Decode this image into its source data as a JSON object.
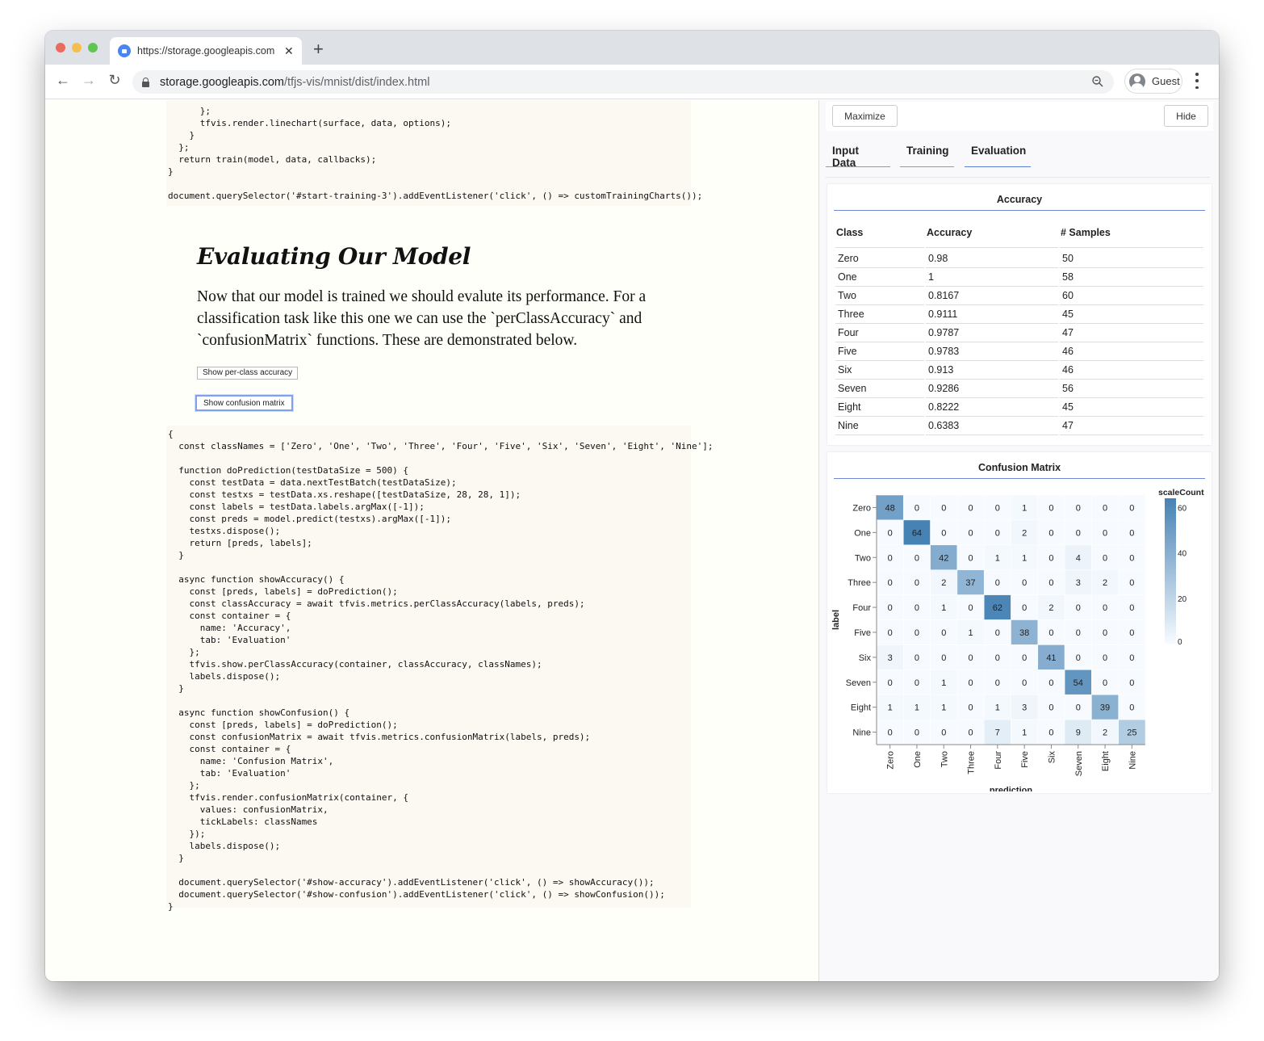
{
  "browser": {
    "tab_title": "https://storage.googleapis.com",
    "tab_close": "✕",
    "new_tab": "+",
    "url_host": "storage.googleapis.com",
    "url_path": "/tfjs-vis/mnist/dist/index.html",
    "profile_label": "Guest",
    "back_icon": "←",
    "forward_icon": "→",
    "reload_icon": "↻"
  },
  "main": {
    "code_top": [
      "      };",
      "      tfvis.render.linechart(surface, data, options);",
      "    }",
      "  };",
      "  return train(model, data, callbacks);",
      "}",
      "",
      "document.querySelector('#start-training-3').addEventListener('click', () => customTrainingCharts());"
    ],
    "heading": "Evaluating Our Model",
    "paragraph": "Now that our model is trained we should evalute its performance. For a classification task like this one we can use the `perClassAccuracy` and `confusionMatrix` functions. These are demonstrated below.",
    "buttons": {
      "accuracy": "Show per-class accuracy",
      "confusion": "Show confusion matrix"
    },
    "code_bottom": [
      "{",
      "  const classNames = ['Zero', 'One', 'Two', 'Three', 'Four', 'Five', 'Six', 'Seven', 'Eight', 'Nine'];",
      "",
      "  function doPrediction(testDataSize = 500) {",
      "    const testData = data.nextTestBatch(testDataSize);",
      "    const testxs = testData.xs.reshape([testDataSize, 28, 28, 1]);",
      "    const labels = testData.labels.argMax([-1]);",
      "    const preds = model.predict(testxs).argMax([-1]);",
      "    testxs.dispose();",
      "    return [preds, labels];",
      "  }",
      "",
      "  async function showAccuracy() {",
      "    const [preds, labels] = doPrediction();",
      "    const classAccuracy = await tfvis.metrics.perClassAccuracy(labels, preds);",
      "    const container = {",
      "      name: 'Accuracy',",
      "      tab: 'Evaluation'",
      "    };",
      "    tfvis.show.perClassAccuracy(container, classAccuracy, classNames);",
      "    labels.dispose();",
      "  }",
      "",
      "  async function showConfusion() {",
      "    const [preds, labels] = doPrediction();",
      "    const confusionMatrix = await tfvis.metrics.confusionMatrix(labels, preds);",
      "    const container = {",
      "      name: 'Confusion Matrix',",
      "      tab: 'Evaluation'",
      "    };",
      "    tfvis.render.confusionMatrix(container, {",
      "      values: confusionMatrix,",
      "      tickLabels: classNames",
      "    });",
      "    labels.dispose();",
      "  }",
      "",
      "  document.querySelector('#show-accuracy').addEventListener('click', () => showAccuracy());",
      "  document.querySelector('#show-confusion').addEventListener('click', () => showConfusion());",
      "}"
    ]
  },
  "visor": {
    "maximize_label": "Maximize",
    "hide_label": "Hide",
    "tabs": [
      {
        "label": "Input Data",
        "active": false
      },
      {
        "label": "Training",
        "active": false
      },
      {
        "label": "Evaluation",
        "active": true
      }
    ],
    "accent": "#5b7fd4",
    "accuracy": {
      "title": "Accuracy",
      "headers": [
        "Class",
        "Accuracy",
        "# Samples"
      ],
      "rows": [
        [
          "Zero",
          "0.98",
          "50"
        ],
        [
          "One",
          "1",
          "58"
        ],
        [
          "Two",
          "0.8167",
          "60"
        ],
        [
          "Three",
          "0.9111",
          "45"
        ],
        [
          "Four",
          "0.9787",
          "47"
        ],
        [
          "Five",
          "0.9783",
          "46"
        ],
        [
          "Six",
          "0.913",
          "46"
        ],
        [
          "Seven",
          "0.9286",
          "56"
        ],
        [
          "Eight",
          "0.8222",
          "45"
        ],
        [
          "Nine",
          "0.6383",
          "47"
        ]
      ]
    }
  },
  "chart_data": {
    "type": "heatmap",
    "title": "Confusion Matrix",
    "xlabel": "prediction",
    "ylabel": "label",
    "categories": [
      "Zero",
      "One",
      "Two",
      "Three",
      "Four",
      "Five",
      "Six",
      "Seven",
      "Eight",
      "Nine"
    ],
    "values": [
      [
        48,
        0,
        0,
        0,
        0,
        1,
        0,
        0,
        0,
        0
      ],
      [
        0,
        64,
        0,
        0,
        0,
        2,
        0,
        0,
        0,
        0
      ],
      [
        0,
        0,
        42,
        0,
        1,
        1,
        0,
        4,
        0,
        0
      ],
      [
        0,
        0,
        2,
        37,
        0,
        0,
        0,
        3,
        2,
        0
      ],
      [
        0,
        0,
        1,
        0,
        62,
        0,
        2,
        0,
        0,
        0
      ],
      [
        0,
        0,
        0,
        1,
        0,
        38,
        0,
        0,
        0,
        0
      ],
      [
        3,
        0,
        0,
        0,
        0,
        0,
        41,
        0,
        0,
        0
      ],
      [
        0,
        0,
        1,
        0,
        0,
        0,
        0,
        54,
        0,
        0
      ],
      [
        1,
        1,
        1,
        0,
        1,
        3,
        0,
        0,
        39,
        0
      ],
      [
        0,
        0,
        0,
        0,
        7,
        1,
        0,
        9,
        2,
        25
      ]
    ],
    "legend": {
      "title": "scaleCount",
      "ticks": [
        0,
        20,
        40,
        60
      ],
      "range": [
        0,
        64
      ],
      "placement": "right"
    },
    "color_low": "#f7fbff",
    "color_high": "#4682b4"
  }
}
